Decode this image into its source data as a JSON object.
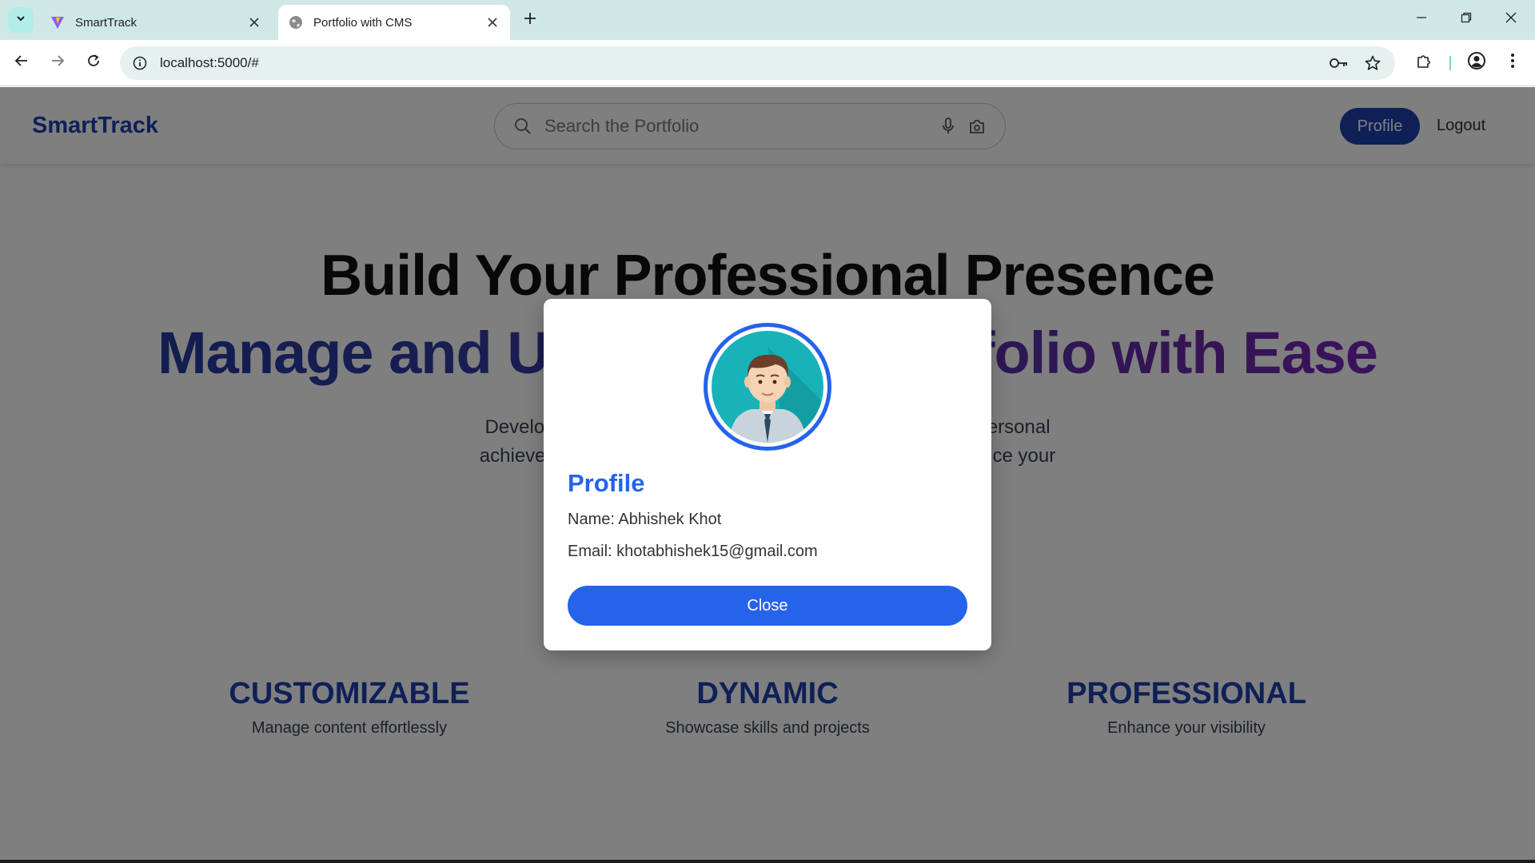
{
  "browser": {
    "tabs": [
      {
        "title": "SmartTrack",
        "icon": "vite-icon"
      },
      {
        "title": "Portfolio with CMS",
        "icon": "globe-icon"
      }
    ],
    "url": "localhost:5000/#"
  },
  "site": {
    "logo": "SmartTrack",
    "search_placeholder": "Search the Portfolio",
    "profile_label": "Profile",
    "logout_label": "Logout"
  },
  "hero": {
    "title": "Build Your Professional Presence",
    "subtitle": "Manage and Update Your Portfolio with Ease",
    "description": "Develop a portfolio that showcases your professional and personal achievements. Our CMS makes it easy to update and enhance your"
  },
  "features": [
    {
      "title": "CUSTOMIZABLE",
      "text": "Manage content effortlessly"
    },
    {
      "title": "DYNAMIC",
      "text": "Showcase skills and projects"
    },
    {
      "title": "PROFESSIONAL",
      "text": "Enhance your visibility"
    }
  ],
  "modal": {
    "title": "Profile",
    "name_line": "Name: Abhishek Khot",
    "email_line": "Email: khotabhishek15@gmail.com",
    "close_label": "Close"
  },
  "colors": {
    "brand": "#1e40af",
    "accent": "#2563eb",
    "gradient_end": "#7e22ce"
  }
}
